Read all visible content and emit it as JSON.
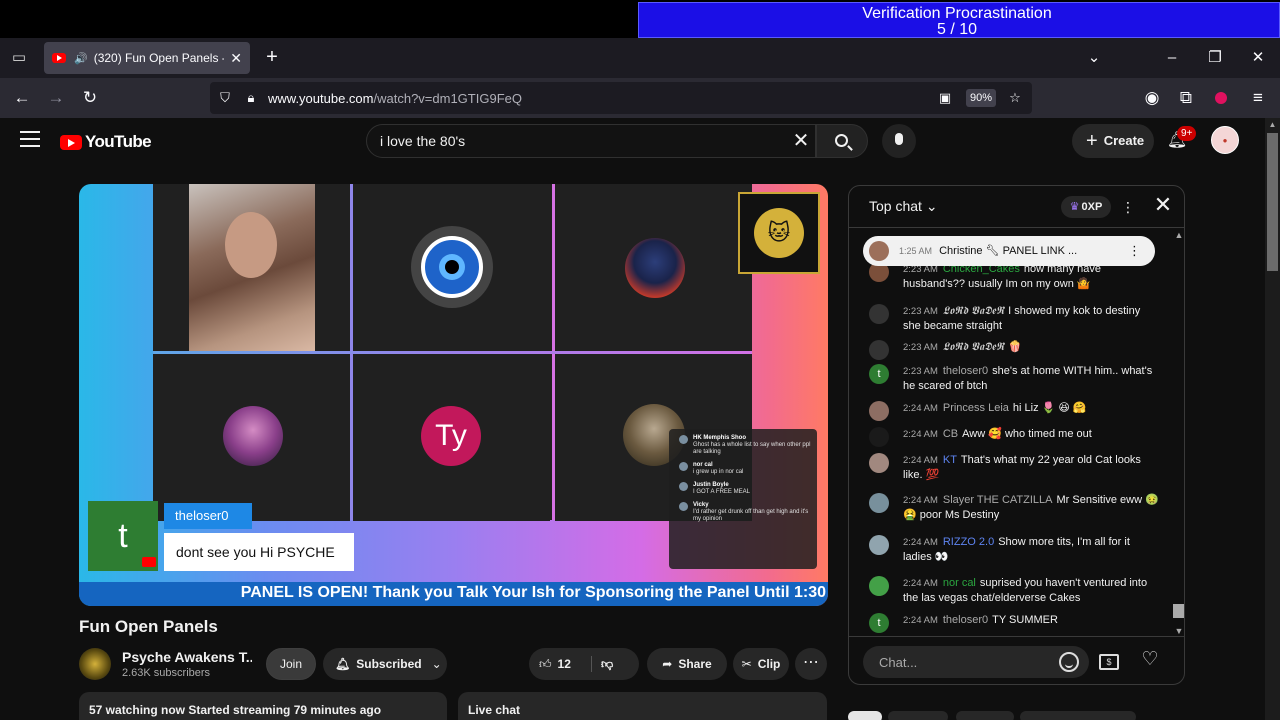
{
  "overlay": {
    "title": "Verification Procrastination",
    "progress": "5 / 10"
  },
  "browser": {
    "tab_title": "(320) Fun Open Panels - YouTube",
    "url_host": "www.youtube.com",
    "url_path": "/watch?v=dm1GTIG9FeQ",
    "zoom": "90%"
  },
  "youtube": {
    "logo_text": "YouTube",
    "search_value": "i love the 80's",
    "search_placeholder": "Search",
    "create_label": "Create",
    "notif_badge": "9+"
  },
  "video": {
    "title": "Fun Open Panels",
    "lower_third_initial": "t",
    "lower_third_name": "theloser0",
    "lower_third_message": "dont see you Hi PSYCHE",
    "ty_initial": "Ty",
    "ticker": "PANEL IS OPEN! Thank you Talk Your Ish for Sponsoring the Panel Until 1:30",
    "mini_chat": [
      {
        "name": "HK Memphis Shoo",
        "text": "Ghost has a whole list to say when other ppl are talking"
      },
      {
        "name": "nor cal",
        "text": "i grew up in nor cal"
      },
      {
        "name": "Justin Boyle",
        "text": "I GOT A FREE MEAL"
      },
      {
        "name": "Vicky",
        "text": "I'd rather get drunk off than get high and it's my opinion"
      }
    ]
  },
  "channel": {
    "name": "Psyche Awakens T...",
    "subscribers": "2.63K subscribers",
    "join_label": "Join",
    "subscribed_label": "Subscribed"
  },
  "actions": {
    "likes": "12",
    "share": "Share",
    "clip": "Clip"
  },
  "description": {
    "meta": "57 watching now  Started streaming 79 minutes ago"
  },
  "live_chat_label": "Live chat",
  "chat": {
    "header": "Top chat",
    "xp": "0XP",
    "pinned": {
      "time": "1:25 AM",
      "author": "Christine",
      "text": "PANEL LINK ..."
    },
    "messages": [
      {
        "time": "2:23 AM",
        "author": "Chicken_Cakes",
        "text": "how many have husband's?? usually Im on my own 🤷"
      },
      {
        "time": "2:23 AM",
        "author": "𝕷𝖔𝕽𝖉 𝖁𝖆𝕯𝖊𝕽",
        "text": "I showed my kok to destiny she became straight"
      },
      {
        "time": "2:23 AM",
        "author": "𝕷𝖔𝕽𝖉 𝖁𝖆𝕯𝖊𝕽",
        "text": "🍿"
      },
      {
        "time": "2:23 AM",
        "author": "theloser0",
        "text": "she's at home WITH him.. what's he scared of btch"
      },
      {
        "time": "2:24 AM",
        "author": "Princess Leia",
        "text": "hi Liz 🌷 😆 🤗"
      },
      {
        "time": "2:24 AM",
        "author": "CB",
        "text": "Aww 🥰 who timed me out"
      },
      {
        "time": "2:24 AM",
        "author": "KT",
        "text": "That's what my 22 year old Cat looks like. 💯"
      },
      {
        "time": "2:24 AM",
        "author": "Slayer THE CATZILLA",
        "text": "Mr Sensitive eww 🤢 🤮 poor Ms Destiny"
      },
      {
        "time": "2:24 AM",
        "author": "RIZZO 2.0",
        "text": "Show more tits, I'm all for it ladies 👀"
      },
      {
        "time": "2:24 AM",
        "author": "nor cal",
        "text": "suprised you haven't ventured into the las vegas chat/elderverse Cakes"
      },
      {
        "time": "2:24 AM",
        "author": "theloser0",
        "text": "TY SUMMER"
      }
    ],
    "input_placeholder": "Chat..."
  }
}
